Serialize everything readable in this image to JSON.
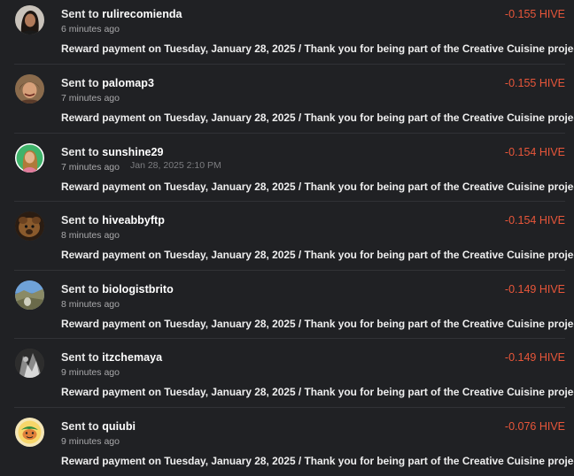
{
  "colors": {
    "background": "#202124",
    "amount": "#e8563a",
    "divider": "#313236"
  },
  "transfers": [
    {
      "prefix": "Sent to",
      "user": "rulirecomienda",
      "time": "6 minutes ago",
      "amount": "-0.155 HIVE",
      "memo": "Reward payment on Tuesday, January 28, 2025 / Thank you for being part of the Creative Cuisine project.",
      "avatar": "rulirecomienda-avatar"
    },
    {
      "prefix": "Sent to",
      "user": "palomap3",
      "time": "7 minutes ago",
      "amount": "-0.155 HIVE",
      "memo": "Reward payment on Tuesday, January 28, 2025 / Thank you for being part of the Creative Cuisine project.",
      "avatar": "palomap3-avatar"
    },
    {
      "prefix": "Sent to",
      "user": "sunshine29",
      "time": "7 minutes ago",
      "tooltip": "Jan 28, 2025 2:10 PM",
      "amount": "-0.154 HIVE",
      "memo": "Reward payment on Tuesday, January 28, 2025 / Thank you for being part of the Creative Cuisine project.",
      "avatar": "sunshine29-avatar"
    },
    {
      "prefix": "Sent to",
      "user": "hiveabbyftp",
      "time": "8 minutes ago",
      "amount": "-0.154 HIVE",
      "memo": "Reward payment on Tuesday, January 28, 2025 / Thank you for being part of the Creative Cuisine project.",
      "avatar": "hiveabbyftp-avatar"
    },
    {
      "prefix": "Sent to",
      "user": "biologistbrito",
      "time": "8 minutes ago",
      "amount": "-0.149 HIVE",
      "memo": "Reward payment on Tuesday, January 28, 2025 / Thank you for being part of the Creative Cuisine project.",
      "avatar": "biologistbrito-avatar"
    },
    {
      "prefix": "Sent to",
      "user": "itzchemaya",
      "time": "9 minutes ago",
      "amount": "-0.149 HIVE",
      "memo": "Reward payment on Tuesday, January 28, 2025 / Thank you for being part of the Creative Cuisine project.",
      "avatar": "itzchemaya-avatar"
    },
    {
      "prefix": "Sent to",
      "user": "quiubi",
      "time": "9 minutes ago",
      "amount": "-0.076 HIVE",
      "memo": "Reward payment on Tuesday, January 28, 2025 / Thank you for being part of the Creative Cuisine project.",
      "avatar": "quiubi-avatar"
    }
  ]
}
